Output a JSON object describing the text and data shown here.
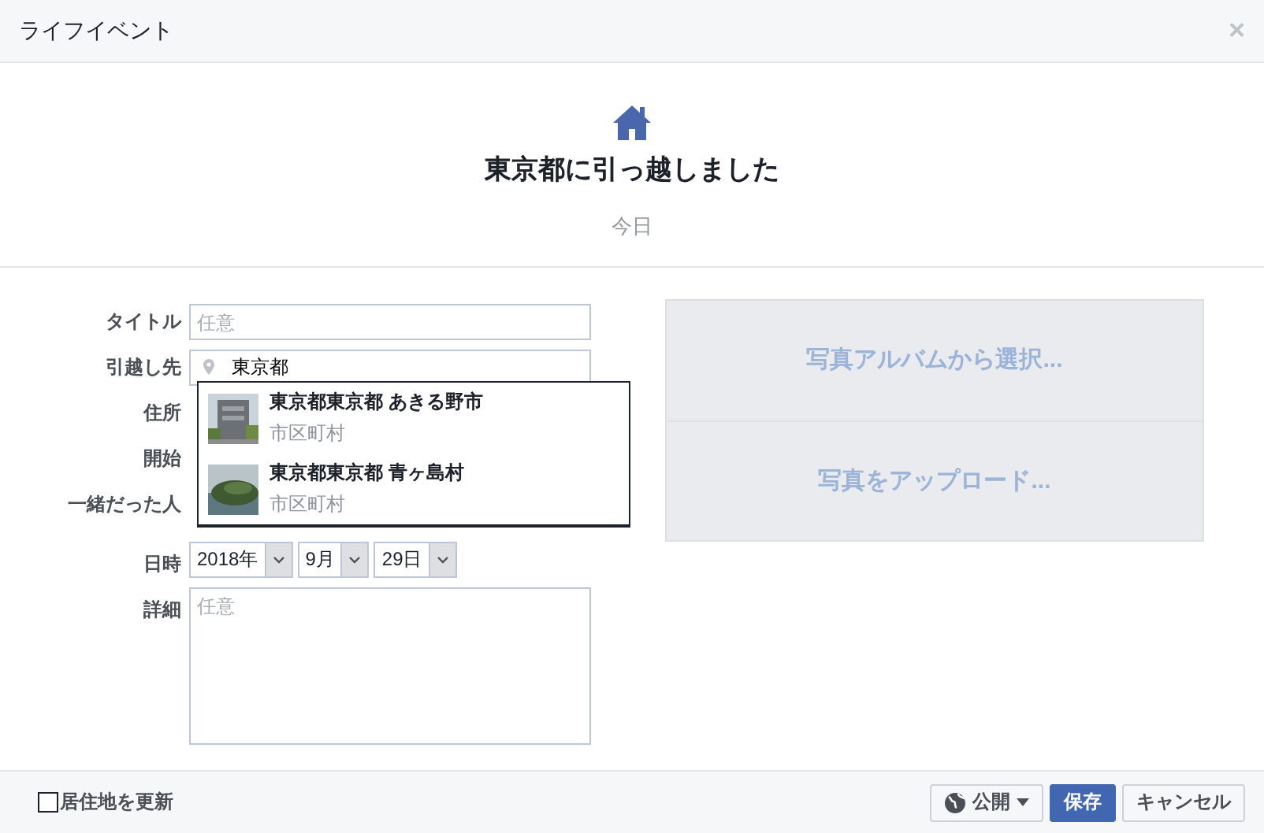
{
  "window": {
    "title": "ライフイベント",
    "close": "×"
  },
  "event": {
    "headline": "東京都に引っ越しました",
    "date": "今日"
  },
  "form": {
    "title": {
      "label": "タイトル",
      "placeholder": "任意"
    },
    "destination": {
      "label": "引越し先",
      "value": "東京都"
    },
    "hidden_labels": [
      "住所",
      "開始",
      "一緒だった人"
    ],
    "suggestions": [
      {
        "name": "東京都東京都 あきる野市",
        "type": "市区町村",
        "kind": "building"
      },
      {
        "name": "東京都東京都 青ヶ島村",
        "type": "市区町村",
        "kind": "island"
      }
    ],
    "date": {
      "label": "日時",
      "year": "2018年",
      "month": "9月",
      "day": "29日"
    },
    "details": {
      "label": "詳細",
      "placeholder": "任意"
    }
  },
  "photo_buttons": [
    "写真アルバムから選択...",
    "写真をアップロード..."
  ],
  "footer": {
    "update_residence": {
      "label": "居住地を更新",
      "checked": false
    },
    "privacy": "公開",
    "save": "保存",
    "cancel": "キャンセル"
  }
}
